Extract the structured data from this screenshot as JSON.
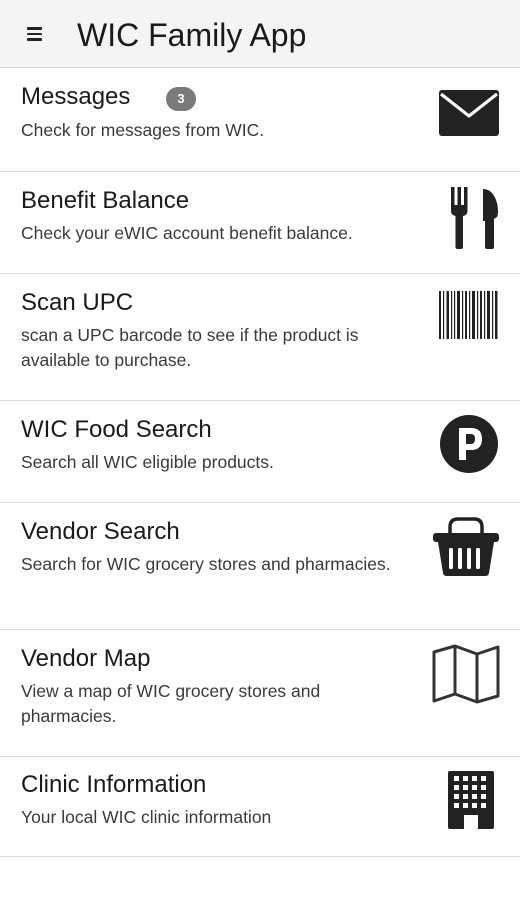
{
  "app": {
    "title": "WIC Family App",
    "menu_icon": "hamburger-menu-icon"
  },
  "items": [
    {
      "title": "Messages",
      "description": "Check for messages from WIC.",
      "badge": "3",
      "icon": "envelope-icon"
    },
    {
      "title": "Benefit Balance",
      "description": "Check your eWIC account benefit balance.",
      "icon": "fork-knife-icon"
    },
    {
      "title": "Scan UPC",
      "description": "scan a UPC barcode to see if the product is available to purchase.",
      "icon": "barcode-icon"
    },
    {
      "title": "WIC Food Search",
      "description": "Search all WIC eligible products.",
      "icon": "product-p-icon"
    },
    {
      "title": "Vendor Search",
      "description": "Search for WIC grocery stores and pharmacies.",
      "icon": "shopping-basket-icon"
    },
    {
      "title": "Vendor Map",
      "description": "View a map of WIC grocery stores and pharmacies.",
      "icon": "folded-map-icon"
    },
    {
      "title": "Clinic Information",
      "description": "Your local WIC clinic information",
      "icon": "building-icon"
    }
  ]
}
